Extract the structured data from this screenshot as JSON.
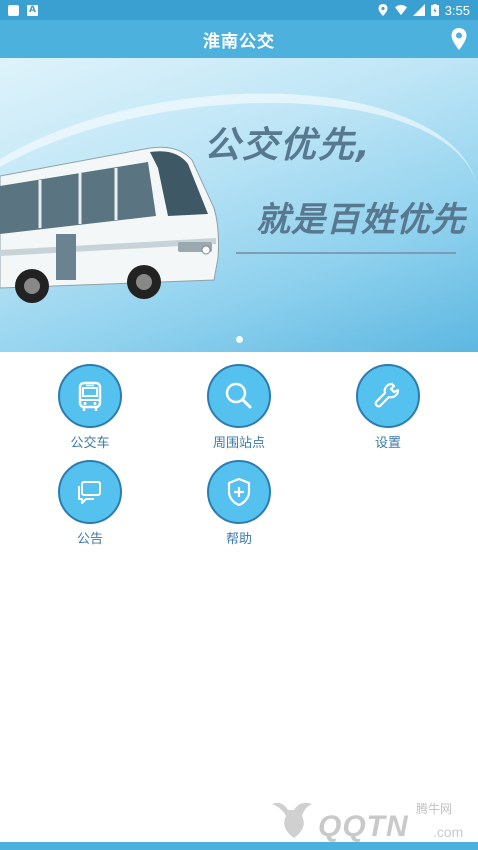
{
  "status_bar": {
    "time": "3:55",
    "app_badge": "A"
  },
  "header": {
    "title": "淮南公交",
    "location_icon": "map-pin-icon"
  },
  "banner": {
    "slogan_line1": "公交优先,",
    "slogan_line2": "就是百姓优先",
    "page_count": 1,
    "active_page": 1
  },
  "menu": [
    {
      "label": "公交车",
      "icon": "bus-icon"
    },
    {
      "label": "周围站点",
      "icon": "search-icon"
    },
    {
      "label": "设置",
      "icon": "wrench-icon"
    },
    {
      "label": "公告",
      "icon": "chat-icon"
    },
    {
      "label": "帮助",
      "icon": "shield-plus-icon"
    }
  ],
  "watermark": {
    "text": "QQTN",
    "small": "腾牛网",
    "suffix": ".com"
  },
  "colors": {
    "primary": "#4db1de",
    "status": "#3a9fd1",
    "tile": "#54c1ef",
    "tile_border": "#2d7cb0",
    "label": "#3c7aa6"
  }
}
